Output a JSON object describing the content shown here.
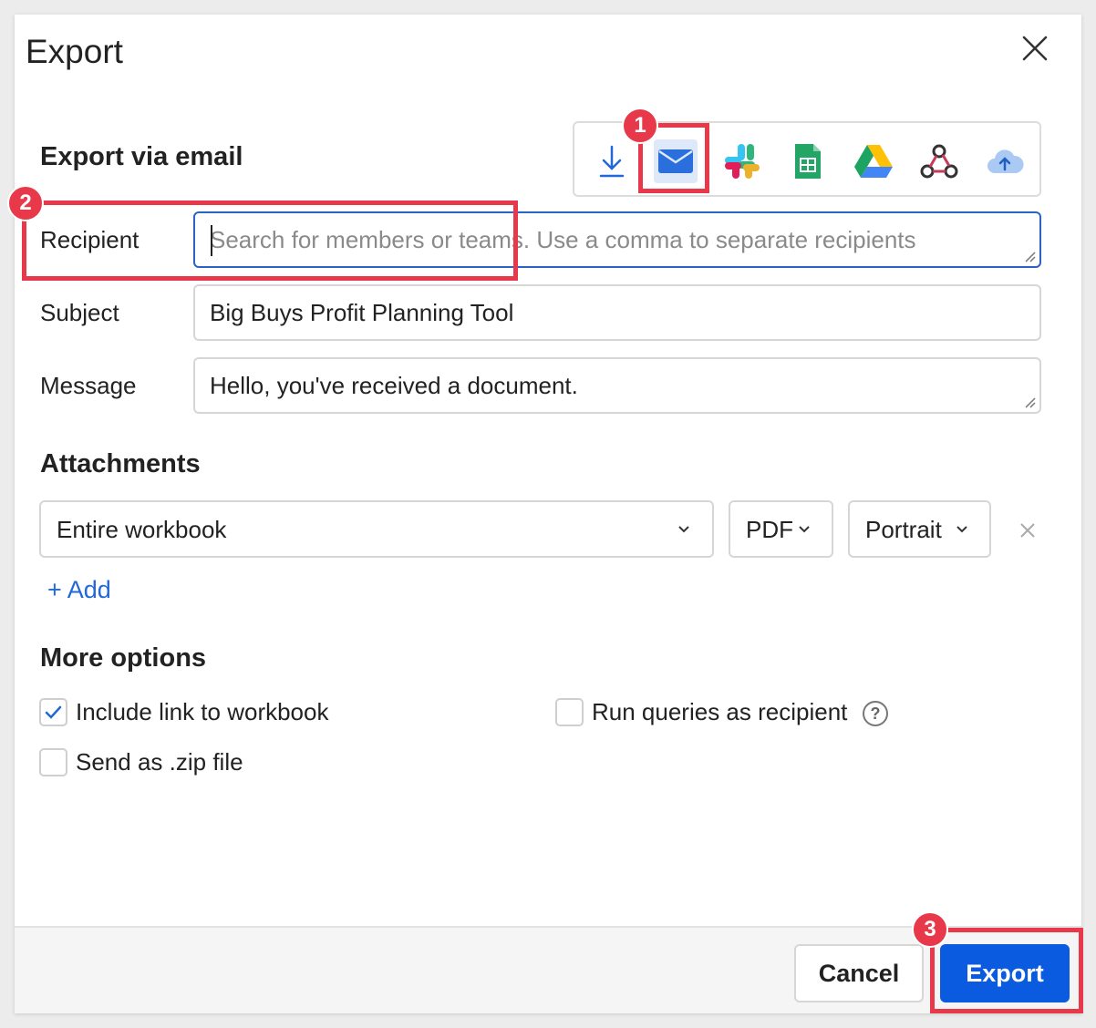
{
  "dialog": {
    "title": "Export",
    "close_label": "×"
  },
  "export_via": {
    "heading": "Export via email",
    "destinations": [
      {
        "name": "download",
        "icon": "download-icon",
        "active": false
      },
      {
        "name": "email",
        "icon": "email-icon",
        "active": true
      },
      {
        "name": "slack",
        "icon": "slack-icon",
        "active": false
      },
      {
        "name": "google-sheets",
        "icon": "google-sheets-icon",
        "active": false
      },
      {
        "name": "google-drive",
        "icon": "google-drive-icon",
        "active": false
      },
      {
        "name": "webhook",
        "icon": "webhook-icon",
        "active": false
      },
      {
        "name": "cloud-storage",
        "icon": "cloud-upload-icon",
        "active": false
      }
    ]
  },
  "form": {
    "recipient_label": "Recipient",
    "recipient_placeholder": "Search for members or teams. Use a comma to separate recipients",
    "recipient_value": "",
    "subject_label": "Subject",
    "subject_value": "Big Buys Profit Planning Tool",
    "message_label": "Message",
    "message_value": "Hello, you've received a document."
  },
  "attachments": {
    "heading": "Attachments",
    "content_select": "Entire workbook",
    "format_select": "PDF",
    "orientation_select": "Portrait",
    "add_label": "+ Add"
  },
  "more_options": {
    "heading": "More options",
    "include_link_label": "Include link to workbook",
    "include_link_checked": true,
    "run_queries_label": "Run queries as recipient",
    "run_queries_checked": false,
    "zip_label": "Send as .zip file",
    "zip_checked": false,
    "help_symbol": "?"
  },
  "footer": {
    "cancel_label": "Cancel",
    "export_label": "Export"
  },
  "annotations": {
    "badge_1": "1",
    "badge_2": "2",
    "badge_3": "3",
    "highlight_color": "#e8394a"
  },
  "colors": {
    "primary": "#0a5be0",
    "focus_border": "#2a63c7",
    "link": "#2268d6",
    "active_tab_bg": "#dde8f9"
  }
}
